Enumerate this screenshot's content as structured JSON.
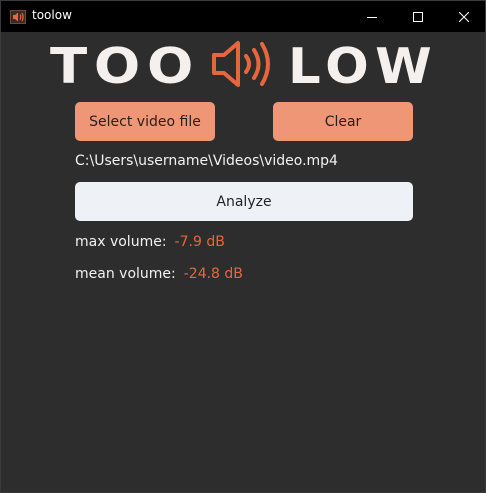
{
  "window": {
    "title": "toolow",
    "icon": "speaker-icon"
  },
  "titlebar_buttons": [
    "minimize-icon",
    "maximize-icon",
    "close-icon"
  ],
  "logo": {
    "left_text": "TOO",
    "right_text": "LOW",
    "icon": "speaker-icon",
    "text_color": "#f4f0ee",
    "icon_color": "#e8663e"
  },
  "buttons": {
    "select_file": "Select video file",
    "clear": "Clear",
    "analyze": "Analyze"
  },
  "file_path": "C:\\Users\\username\\Videos\\video.mp4",
  "stats": {
    "max_label": "max volume:",
    "max_value": "-7.9 dB",
    "mean_label": "mean volume:",
    "mean_value": "-24.8 dB"
  },
  "colors": {
    "background": "#2d2d2d",
    "accent": "#ef9676",
    "value_text": "#e8663e",
    "analyze_button": "#eef2f6"
  }
}
